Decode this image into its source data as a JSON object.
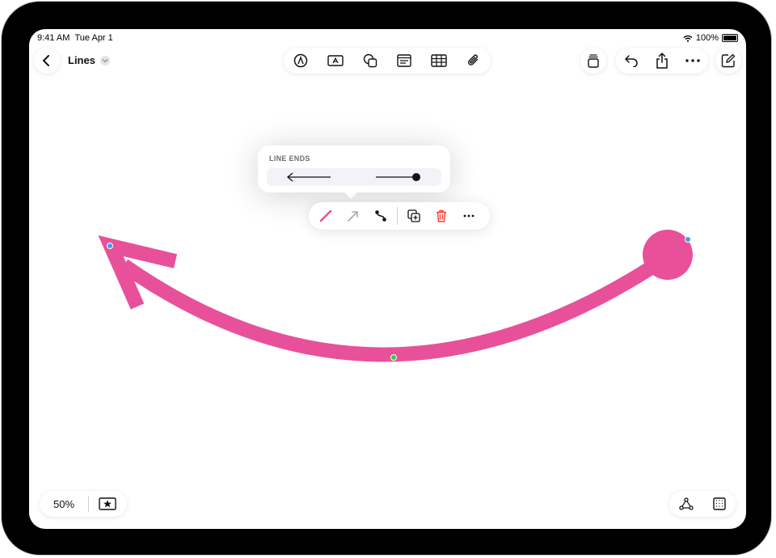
{
  "status_bar": {
    "time": "9:41 AM",
    "date": "Tue Apr 1",
    "battery": "100%"
  },
  "document": {
    "title": "Lines"
  },
  "popover": {
    "title": "LINE ENDS"
  },
  "zoom": {
    "level": "50%"
  },
  "colors": {
    "accent": "#e8519a",
    "handle_blue": "#3a9ff0",
    "handle_green": "#2fce44",
    "delete_red": "#ff3b30"
  },
  "icons": {
    "top_left": [
      "back-icon"
    ],
    "insert_toolbar": [
      "pencil-circle-icon",
      "text-box-icon",
      "shapes-icon",
      "media-icon",
      "table-icon",
      "paperclip-icon"
    ],
    "right_toolbar": [
      "stack-icon",
      "undo-icon",
      "share-icon",
      "more-icon",
      "compose-icon"
    ],
    "context_menu": [
      "line-style-icon",
      "arrow-icon",
      "connection-icon",
      "duplicate-icon",
      "delete-icon",
      "more-icon"
    ],
    "bottom_left": [
      "favorites-star-icon"
    ],
    "bottom_right": [
      "connect-nodes-icon",
      "grid-icon"
    ]
  }
}
